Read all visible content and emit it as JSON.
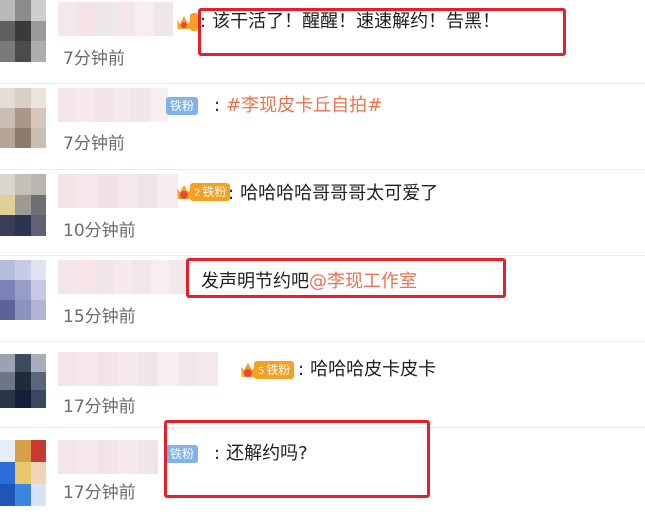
{
  "comments": [
    {
      "badge": "",
      "badge_level": "",
      "colon": ":",
      "text_parts": [
        {
          "t": "该干活了！醒醒！速速解约！告黑！",
          "hl": false
        }
      ],
      "time": "7分钟前"
    },
    {
      "badge": "铁粉",
      "badge_level": "",
      "colon": ":",
      "text_parts": [
        {
          "t": "#李现皮卡丘自拍#",
          "hl": true
        }
      ],
      "time": "7分钟前"
    },
    {
      "badge": "铁粉",
      "badge_level": "2",
      "colon": ":",
      "text_parts": [
        {
          "t": "哈哈哈哈哥哥哥太可爱了",
          "hl": false
        }
      ],
      "time": "10分钟前"
    },
    {
      "badge": "",
      "badge_level": "",
      "colon": "",
      "text_parts": [
        {
          "t": "发声明节约吧",
          "hl": false
        },
        {
          "t": "@李现工作室",
          "hl": true
        }
      ],
      "time": "15分钟前"
    },
    {
      "badge": "铁粉",
      "badge_level": "5",
      "colon": ":",
      "text_parts": [
        {
          "t": "哈哈哈皮卡皮卡",
          "hl": false
        }
      ],
      "time": "17分钟前"
    },
    {
      "badge": "铁粉",
      "badge_level": "",
      "colon": ":",
      "text_parts": [
        {
          "t": "还解约吗?",
          "hl": false
        }
      ],
      "time": "17分钟前"
    }
  ],
  "colors": {
    "highlight": "#eb7350",
    "redbox": "#e5202a",
    "badge_blue": "#7fb3ec",
    "badge_orange": "#f3a024"
  }
}
